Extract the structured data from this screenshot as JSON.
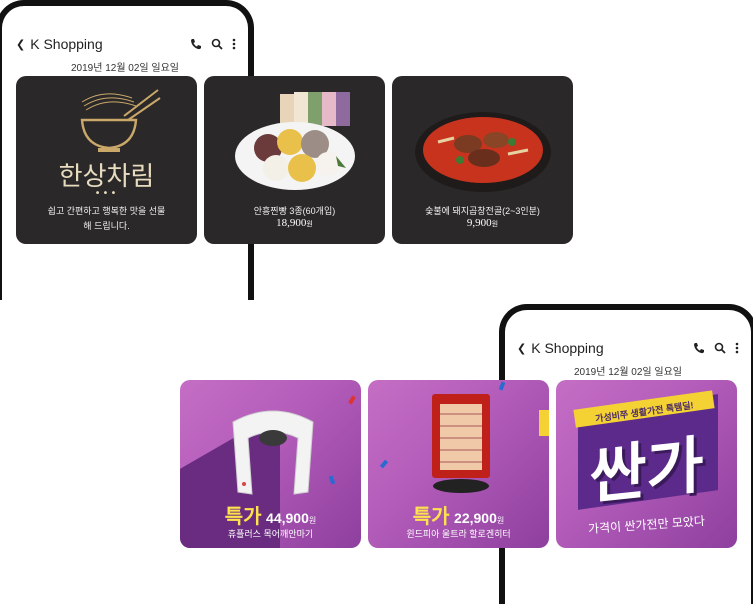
{
  "app": {
    "title": "K Shopping",
    "date": "2019년 12월 02일 일요일"
  },
  "food_cards": [
    {
      "logo": "한상차림",
      "caption": "쉽고 간편하고 행복한 맛을 선물해 드립니다."
    },
    {
      "caption": "안흥찐빵 3종(60개입)",
      "price": "18,900",
      "unit": "원"
    },
    {
      "caption": "숯불에 돼지곱창전골(2~3인분)",
      "price": "9,900",
      "unit": "원"
    }
  ],
  "promo_cards": [
    {
      "badge": "특가",
      "price": "44,900",
      "unit": "원",
      "caption": "휴플러스 목어깨안마기"
    },
    {
      "badge": "특가",
      "price": "22,900",
      "unit": "원",
      "caption": "윈드피아 울트라 할로겐히터"
    },
    {
      "ribbon": "가성비쭈 생활가전 특템딜!",
      "big": "싼가",
      "sub": "가격이 싼가전만 모았다"
    }
  ],
  "icons": [
    "back-arrow-icon",
    "phone-icon",
    "search-icon",
    "more-vertical-icon"
  ],
  "colors": {
    "food_bg": "#2a2828",
    "promo_purple": "#b25bb9",
    "accent_yellow": "#ffe34d"
  }
}
